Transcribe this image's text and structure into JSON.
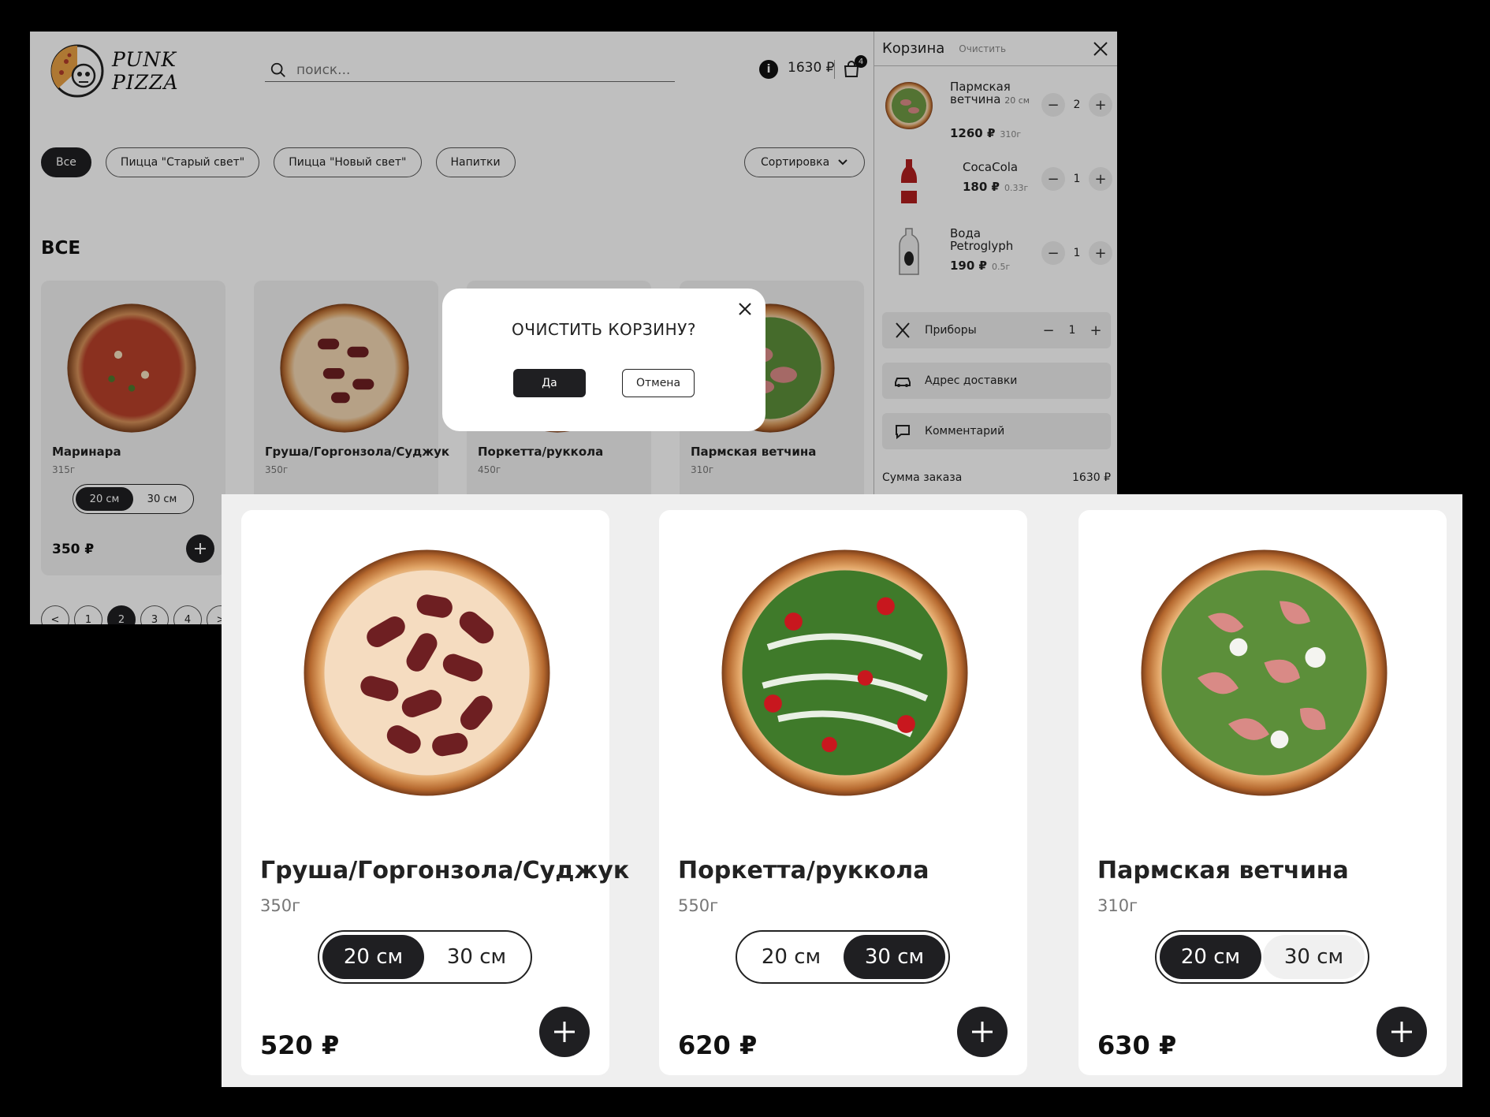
{
  "logo": {
    "line1": "PUNK",
    "line2": "PIZZA"
  },
  "search": {
    "placeholder": "поиск..."
  },
  "header": {
    "info": "i",
    "total": "1630 ₽",
    "bag_count": "4"
  },
  "categories": [
    "Все",
    "Пицца \"Старый свет\"",
    "Пицца \"Новый свет\"",
    "Напитки"
  ],
  "sort_label": "Сортировка",
  "section_title": "ВСЕ",
  "bg_products": [
    {
      "name": "Маринара",
      "weight": "315г",
      "price": "350 ₽",
      "size1": "20 см",
      "size2": "30 см"
    },
    {
      "name": "Груша/Горгонзола/Суджук",
      "weight": "350г"
    },
    {
      "name": "Поркетта/руккола",
      "weight": "450г"
    },
    {
      "name": "Пармская ветчина",
      "weight": "310г"
    }
  ],
  "pagination": [
    "<",
    "1",
    "2",
    "3",
    "4",
    ">"
  ],
  "cart": {
    "title": "Корзина",
    "clear_label": "Очистить",
    "items": [
      {
        "name": "Пармская ветчина",
        "size": "20 см",
        "price": "1260 ₽",
        "weight": "310г",
        "qty": "2"
      },
      {
        "name": "CocaCola",
        "price": "180 ₽",
        "weight": "0.33г",
        "qty": "1"
      },
      {
        "name": "Вода Petroglyph",
        "price": "190 ₽",
        "weight": "0.5г",
        "qty": "1"
      }
    ],
    "cutlery": {
      "label": "Приборы",
      "qty": "1"
    },
    "address_label": "Адрес доставки",
    "comment_label": "Комментарий",
    "sum_label": "Сумма заказа",
    "sum_value": "1630 ₽"
  },
  "modal": {
    "title": "ОЧИСТИТЬ КОРЗИНУ?",
    "yes": "Да",
    "cancel": "Отмена"
  },
  "cards": [
    {
      "name": "Груша/Горгонзола/Суджук",
      "weight": "350г",
      "size1": "20 см",
      "size2": "30 см",
      "selected": "20 см",
      "price": "520 ₽"
    },
    {
      "name": "Поркетта/руккола",
      "weight": "550г",
      "size1": "20 см",
      "size2": "30 см",
      "selected": "30 см",
      "price": "620 ₽"
    },
    {
      "name": "Пармская ветчина",
      "weight": "310г",
      "size1": "20 см",
      "size2": "30 см",
      "selected": "20 см",
      "price": "630 ₽"
    }
  ],
  "colors": {
    "dark": "#1f1f22",
    "panel_bg": "#efefef",
    "crust": "#d89a55",
    "salami": "#6e1f22",
    "arugula": "#3f7a2a",
    "ham": "#d98a86"
  }
}
